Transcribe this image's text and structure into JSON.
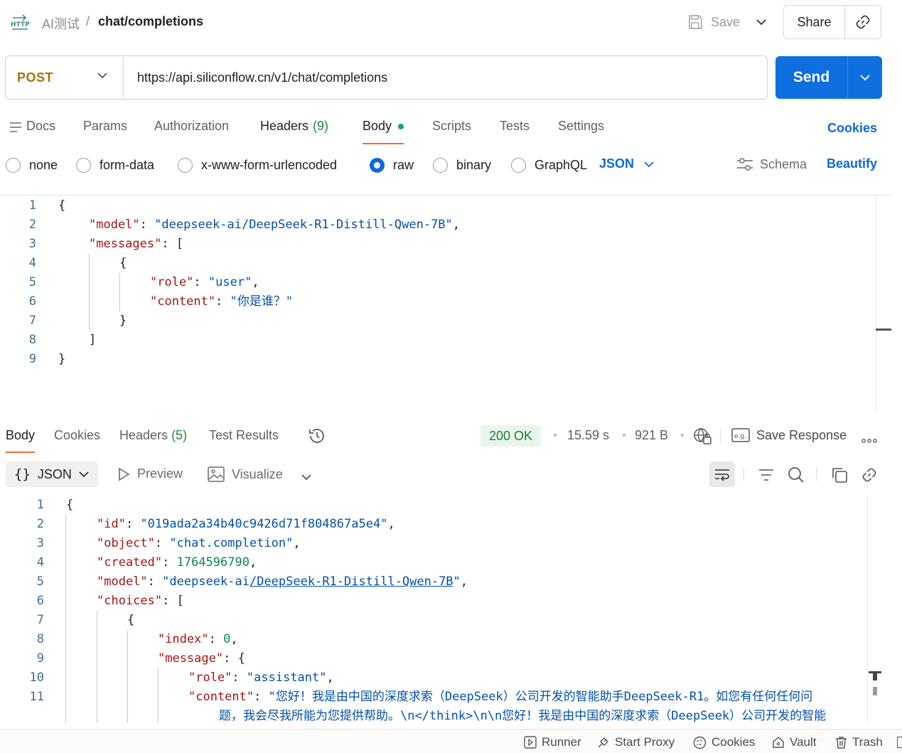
{
  "header": {
    "icon": "http-icon",
    "icon_label": "HTTP",
    "breadcrumb_parent": "AI测试",
    "breadcrumb_sep": "/",
    "breadcrumb_current": "chat/completions",
    "save_label": "Save",
    "share_label": "Share"
  },
  "request": {
    "method": "POST",
    "url": "https://api.siliconflow.cn/v1/chat/completions",
    "send_label": "Send"
  },
  "request_tabs": {
    "docs": "Docs",
    "params": "Params",
    "authorization": "Authorization",
    "headers": "Headers",
    "headers_count": "(9)",
    "body": "Body",
    "scripts": "Scripts",
    "tests": "Tests",
    "settings": "Settings",
    "cookies": "Cookies"
  },
  "body_types": {
    "none": "none",
    "form_data": "form-data",
    "urlencoded": "x-www-form-urlencoded",
    "raw": "raw",
    "binary": "binary",
    "graphql": "GraphQL",
    "selected": "raw",
    "format": "JSON",
    "schema": "Schema",
    "beautify": "Beautify"
  },
  "request_body": {
    "line_numbers": [
      "1",
      "2",
      "3",
      "4",
      "5",
      "6",
      "7",
      "8",
      "9"
    ],
    "model_key": "\"model\"",
    "model_val": "\"deepseek-ai/DeepSeek-R1-Distill-Qwen-7B\"",
    "messages_key": "\"messages\"",
    "role_key": "\"role\"",
    "role_val": "\"user\"",
    "content_key": "\"content\"",
    "content_val": "\"你是谁？\""
  },
  "response_tabs": {
    "body": "Body",
    "cookies": "Cookies",
    "headers": "Headers",
    "headers_count": "(5)",
    "test_results": "Test Results",
    "status": "200 OK",
    "time": "15.59 s",
    "size": "921 B",
    "save_response": "Save Response"
  },
  "response_toolbar": {
    "format": "JSON",
    "preview": "Preview",
    "visualize": "Visualize"
  },
  "response_body": {
    "line_numbers": [
      "1",
      "2",
      "3",
      "4",
      "5",
      "6",
      "7",
      "8",
      "9",
      "10",
      "11"
    ],
    "id_key": "\"id\"",
    "id_val": "\"019ada2a34b40c9426d71f804867a5e4\"",
    "object_key": "\"object\"",
    "object_val": "\"chat.completion\"",
    "created_key": "\"created\"",
    "created_val": "1764596790",
    "model_key": "\"model\"",
    "model_val_a": "\"deepseek-ai",
    "model_val_b": "/DeepSeek-R1-Distill-Qwen-7B",
    "model_val_c": "\"",
    "choices_key": "\"choices\"",
    "index_key": "\"index\"",
    "index_val": "0",
    "message_key": "\"message\"",
    "role_key": "\"role\"",
    "role_val": "\"assistant\"",
    "content_key": "\"content\"",
    "content_val_1": "\"您好！我是由中国的深度求索（DeepSeek）公司开发的智能助手DeepSeek-R1。如您有任何任何问",
    "content_val_2": "题，我会尽我所能为您提供帮助。\\n</think>\\n\\n您好！我是由中国的深度求索（DeepSeek）公司开发的智能"
  },
  "status_bar": {
    "runner": "Runner",
    "start_proxy": "Start Proxy",
    "cookies": "Cookies",
    "vault": "Vault",
    "trash": "Trash"
  },
  "colors": {
    "accent": "#0f6fde",
    "method": "#a07600",
    "tab_underline": "#f26b3a",
    "status_ok": "#1b7f3a",
    "json_key": "#a31515",
    "json_string": "#0451a5",
    "json_number": "#098658"
  }
}
